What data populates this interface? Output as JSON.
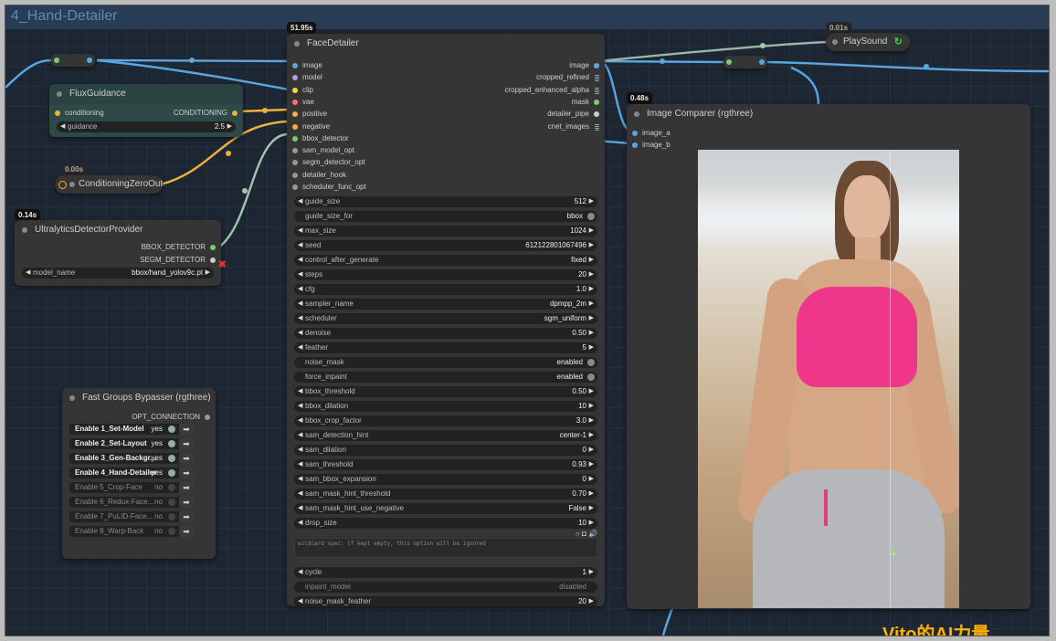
{
  "group": {
    "title": "4_Hand-Detailer"
  },
  "colors": {
    "canvas_bg": "#1d2734",
    "group_bar": "#283d55",
    "wire_image": "#5aa7e0",
    "wire_cond": "#f0b040",
    "wire_bbox": "#9fc6b0"
  },
  "face_detailer": {
    "title": "FaceDetailer",
    "timing": "51.95s",
    "inputs": [
      "image",
      "model",
      "clip",
      "vae",
      "positive",
      "negative",
      "bbox_detector",
      "sam_model_opt",
      "segm_detector_opt",
      "detailer_hook",
      "scheduler_func_opt"
    ],
    "outputs": [
      "image",
      "cropped_refined",
      "cropped_enhanced_alpha",
      "mask",
      "detailer_pipe",
      "cnet_images"
    ],
    "widgets": [
      {
        "label": "guide_size",
        "value": "512"
      },
      {
        "label": "guide_size_for",
        "value": "bbox"
      },
      {
        "label": "max_size",
        "value": "1024"
      },
      {
        "label": "seed",
        "value": "612122801067496"
      },
      {
        "label": "control_after_generate",
        "value": "fixed"
      },
      {
        "label": "steps",
        "value": "20"
      },
      {
        "label": "cfg",
        "value": "1.0"
      },
      {
        "label": "sampler_name",
        "value": "dpmpp_2m"
      },
      {
        "label": "scheduler",
        "value": "sgm_uniform"
      },
      {
        "label": "denoise",
        "value": "0.50"
      },
      {
        "label": "feather",
        "value": "5"
      },
      {
        "label": "noise_mask",
        "value": "enabled"
      },
      {
        "label": "force_inpaint",
        "value": "enabled"
      },
      {
        "label": "bbox_threshold",
        "value": "0.50"
      },
      {
        "label": "bbox_dilation",
        "value": "10"
      },
      {
        "label": "bbox_crop_factor",
        "value": "3.0"
      },
      {
        "label": "sam_detection_hint",
        "value": "center-1"
      },
      {
        "label": "sam_dilation",
        "value": "0"
      },
      {
        "label": "sam_threshold",
        "value": "0.93"
      },
      {
        "label": "sam_bbox_expansion",
        "value": "0"
      },
      {
        "label": "sam_mask_hint_threshold",
        "value": "0.70"
      },
      {
        "label": "sam_mask_hint_use_negative",
        "value": "False"
      },
      {
        "label": "drop_size",
        "value": "10"
      }
    ],
    "wildcard_placeholder": "wildcard spec: if kept empty, this option will be ignored",
    "bottom_widgets": [
      {
        "label": "cycle",
        "value": "1"
      },
      {
        "label": "inpaint_model",
        "value": "disabled"
      },
      {
        "label": "noise_mask_feather",
        "value": "20"
      }
    ]
  },
  "flux_guidance": {
    "title": "FluxGuidance",
    "input": "conditioning",
    "output": "CONDITIONING",
    "widget_label": "guidance",
    "widget_value": "2.5"
  },
  "zero_out": {
    "title": "ConditioningZeroOut",
    "timing": "0.00s"
  },
  "ultralytics": {
    "title": "UltralyticsDetectorProvider",
    "timing": "0.14s",
    "outputs": [
      "BBOX_DETECTOR",
      "SEGM_DETECTOR"
    ],
    "widget_label": "model_name",
    "widget_value": "bbox/hand_yolov9c.pt"
  },
  "bypasser": {
    "title": "Fast Groups Bypasser (rgthree)",
    "output": "OPT_CONNECTION",
    "items": [
      {
        "label": "Enable 1_Set-Model",
        "value": "yes"
      },
      {
        "label": "Enable 2_Set-Layout",
        "value": "yes"
      },
      {
        "label": "Enable 3_Gen-Backgr...",
        "value": "yes"
      },
      {
        "label": "Enable 4_Hand-Detailer",
        "value": "yes"
      },
      {
        "label": "Enable 5_Crop-Face",
        "value": "no"
      },
      {
        "label": "Enable 6_Redux-Face...",
        "value": "no"
      },
      {
        "label": "Enable 7_PuLID-Face...",
        "value": "no"
      },
      {
        "label": "Enable 8_Warp-Back",
        "value": "no"
      }
    ]
  },
  "comparer": {
    "title": "Image Comparer (rgthree)",
    "timing": "0.48s",
    "inputs": [
      "image_a",
      "image_b"
    ]
  },
  "playsound": {
    "title": "PlaySound",
    "timing": "0.01s"
  },
  "watermark": "Vito的AI力量"
}
